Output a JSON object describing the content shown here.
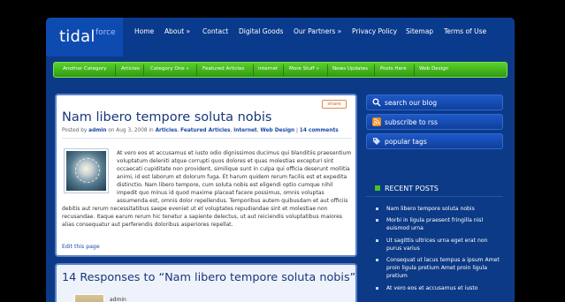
{
  "logo": {
    "main": "tidal",
    "sub": "force"
  },
  "topnav": [
    "Home",
    "About »",
    "Contact",
    "Digital Goods",
    "Our Partners »",
    "Privacy Policy",
    "Sitemap",
    "Terms of Use"
  ],
  "greenmenu": [
    "Another Category",
    "Articles",
    "Category One »",
    "Featured Articles",
    "internet",
    "More Stuff »",
    "News Updates",
    "Posts Here",
    "Web Design"
  ],
  "post": {
    "share": "share",
    "title": "Nam libero tempore soluta nobis",
    "meta_prefix": "Posted by",
    "author": "admin",
    "date_text": "on Aug 3, 2008 in",
    "categories": [
      "Articles",
      "Featured Articles",
      "internet",
      "Web Design"
    ],
    "comments": "14 comments",
    "body": "At vero eos et accusamus et iusto odio dignissimos ducimus qui blanditiis praesentium voluptatum deleniti atque corrupti quos dolores et quas molestias excepturi sint occaecati cupiditate non provident, similique sunt in culpa qui officia deserunt mollitia animi, id est laborum et dolorum fuga. Et harum quidem rerum facilis est et expedita distinctio. Nam libero tempore, cum soluta nobis est eligendi optio cumque nihil impedit quo minus id quod maxime placeat facere possimus, omnis voluptas assumenda est, omnis dolor repellendus. Temporibus autem quibusdam et aut officiis debitis aut rerum necessitatibus saepe eveniet ut et voluptates repudiandae sint et molestiae non recusandae. Itaque earum rerum hic tenetur a sapiente delectus, ut aut reiciendis voluptatibus maiores alias consequatur aut perferendis doloribus asperiores repellat.",
    "edit": "Edit this page"
  },
  "responses": {
    "title": "14 Responses to “Nam libero tempore soluta nobis”",
    "first_author": "admin"
  },
  "sidebar": {
    "buttons": [
      {
        "label": "search our blog",
        "icon": "search-icon"
      },
      {
        "label": "subscribe to rss",
        "icon": "rss-icon"
      },
      {
        "label": "popular tags",
        "icon": "tag-icon"
      }
    ],
    "recent_heading": "RECENT POSTS",
    "recent": [
      "Nam libero tempore soluta nobis",
      "Morbi in ligula praesent fringilla nisl euismod urna",
      "Ut sagittis ultrices urna eget erat non purus varius",
      "Consequat ut lacus tempus a ipsum Amet proin ligula pretium Amet proin ligula pretium",
      "At vero eos et accusamus et iusto"
    ]
  },
  "colors": {
    "accent_blue": "#0c3a86",
    "green": "#3fb01b",
    "title_blue": "#18387a"
  }
}
